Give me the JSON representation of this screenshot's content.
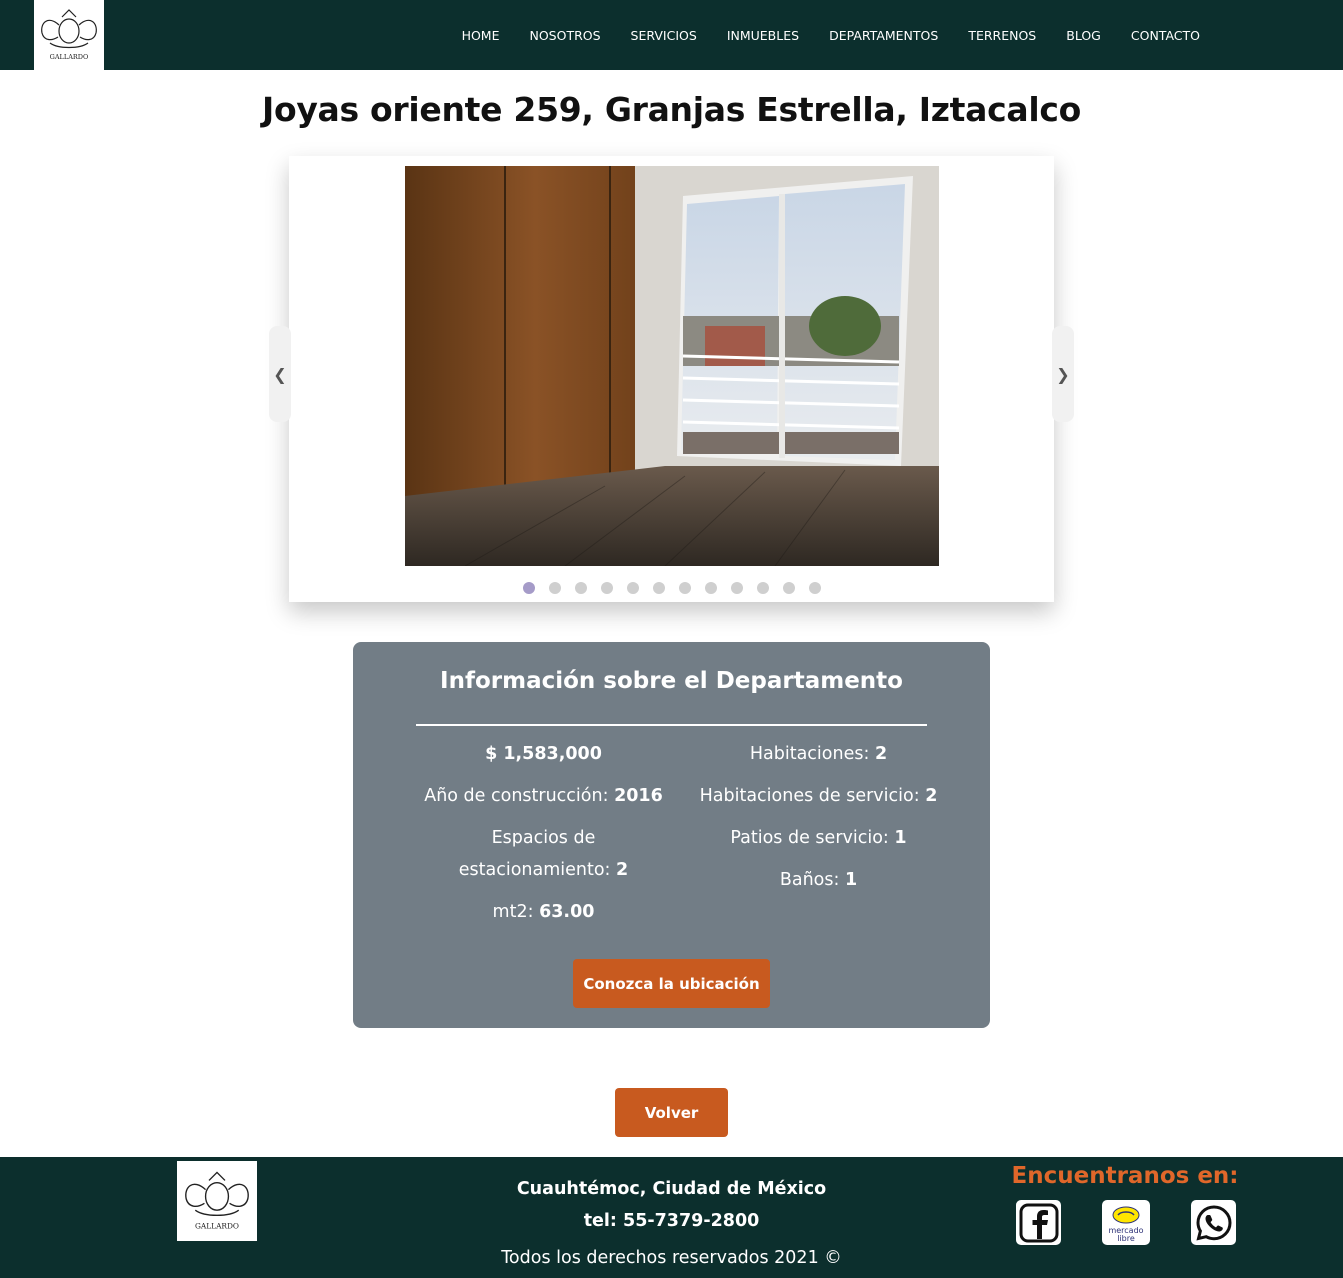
{
  "nav": {
    "logo_text": "GALLARDO",
    "links": [
      "HOME",
      "NOSOTROS",
      "SERVICIOS",
      "INMUEBLES",
      "DEPARTAMENTOS",
      "TERRENOS",
      "BLOG",
      "CONTACTO"
    ]
  },
  "page": {
    "title": "Joyas oriente 259, Granjas Estrella, Iztacalco"
  },
  "carousel": {
    "slide_count": 12,
    "active_slide": 1,
    "prev_icon": "chevron-left-icon",
    "next_icon": "chevron-right-icon"
  },
  "info": {
    "title": "Información sobre el Departamento",
    "price": "$ 1,583,000",
    "year_label": "Año de construcción:",
    "year_value": "2016",
    "parking_label": "Espacios de estacionamiento:",
    "parking_value": "2",
    "area_label": "mt2:",
    "area_value": "63.00",
    "rooms_label": "Habitaciones:",
    "rooms_value": "2",
    "service_rooms_label": "Habitaciones de servicio:",
    "service_rooms_value": "2",
    "service_patios_label": "Patios de servicio:",
    "service_patios_value": "1",
    "baths_label": "Baños:",
    "baths_value": "1",
    "location_button": "Conozca la ubicación"
  },
  "back_button": "Volver",
  "footer": {
    "logo_text": "GALLARDO",
    "address": "Cuauhtémoc, Ciudad de México",
    "phone": "tel: 55-7379-2800",
    "copyright": "Todos los derechos reservados 2021 ©",
    "follow_title": "Encuentranos en:",
    "social_icons": [
      "facebook-icon",
      "mercadolibre-icon",
      "whatsapp-icon"
    ],
    "mercadolibre_text": "mercado libre"
  },
  "colors": {
    "nav_bg": "#0c2f2d",
    "panel_bg": "#727d86",
    "accent": "#c85a1f",
    "follow_title": "#e0672a",
    "dot_active": "#a59bc8"
  }
}
